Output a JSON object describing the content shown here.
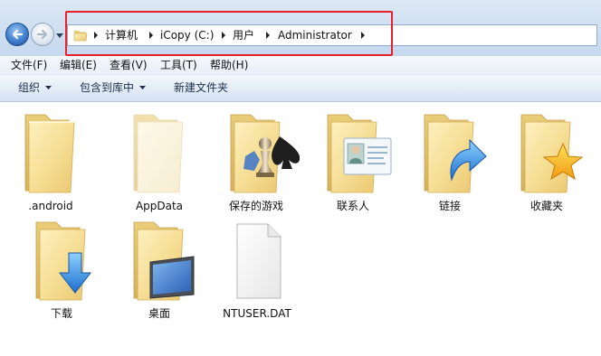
{
  "address_bar": {
    "breadcrumbs": [
      "计算机",
      "iCopy (C:)",
      "用户",
      "Administrator"
    ]
  },
  "menu": {
    "items": [
      "文件(F)",
      "编辑(E)",
      "查看(V)",
      "工具(T)",
      "帮助(H)"
    ]
  },
  "commands": {
    "organize": "组织",
    "include_in_library": "包含到库中",
    "new_folder": "新建文件夹"
  },
  "files": [
    {
      "name": ".android",
      "icon": "folder-icon"
    },
    {
      "name": "AppData",
      "icon": "hidden-folder-icon"
    },
    {
      "name": "保存的游戏",
      "icon": "saved-games-folder-icon"
    },
    {
      "name": "联系人",
      "icon": "contacts-folder-icon"
    },
    {
      "name": "链接",
      "icon": "links-folder-icon"
    },
    {
      "name": "收藏夹",
      "icon": "favorites-folder-icon"
    },
    {
      "name": "下载",
      "icon": "downloads-folder-icon"
    },
    {
      "name": "桌面",
      "icon": "desktop-folder-icon"
    },
    {
      "name": "NTUSER.DAT",
      "icon": "file-icon"
    }
  ],
  "colors": {
    "annotation_highlight": "#e8202a",
    "toolbar_gradient_top": "#f4f8fd",
    "toolbar_gradient_bottom": "#d7e4f3",
    "folder_yellow": "#f2d98a"
  }
}
